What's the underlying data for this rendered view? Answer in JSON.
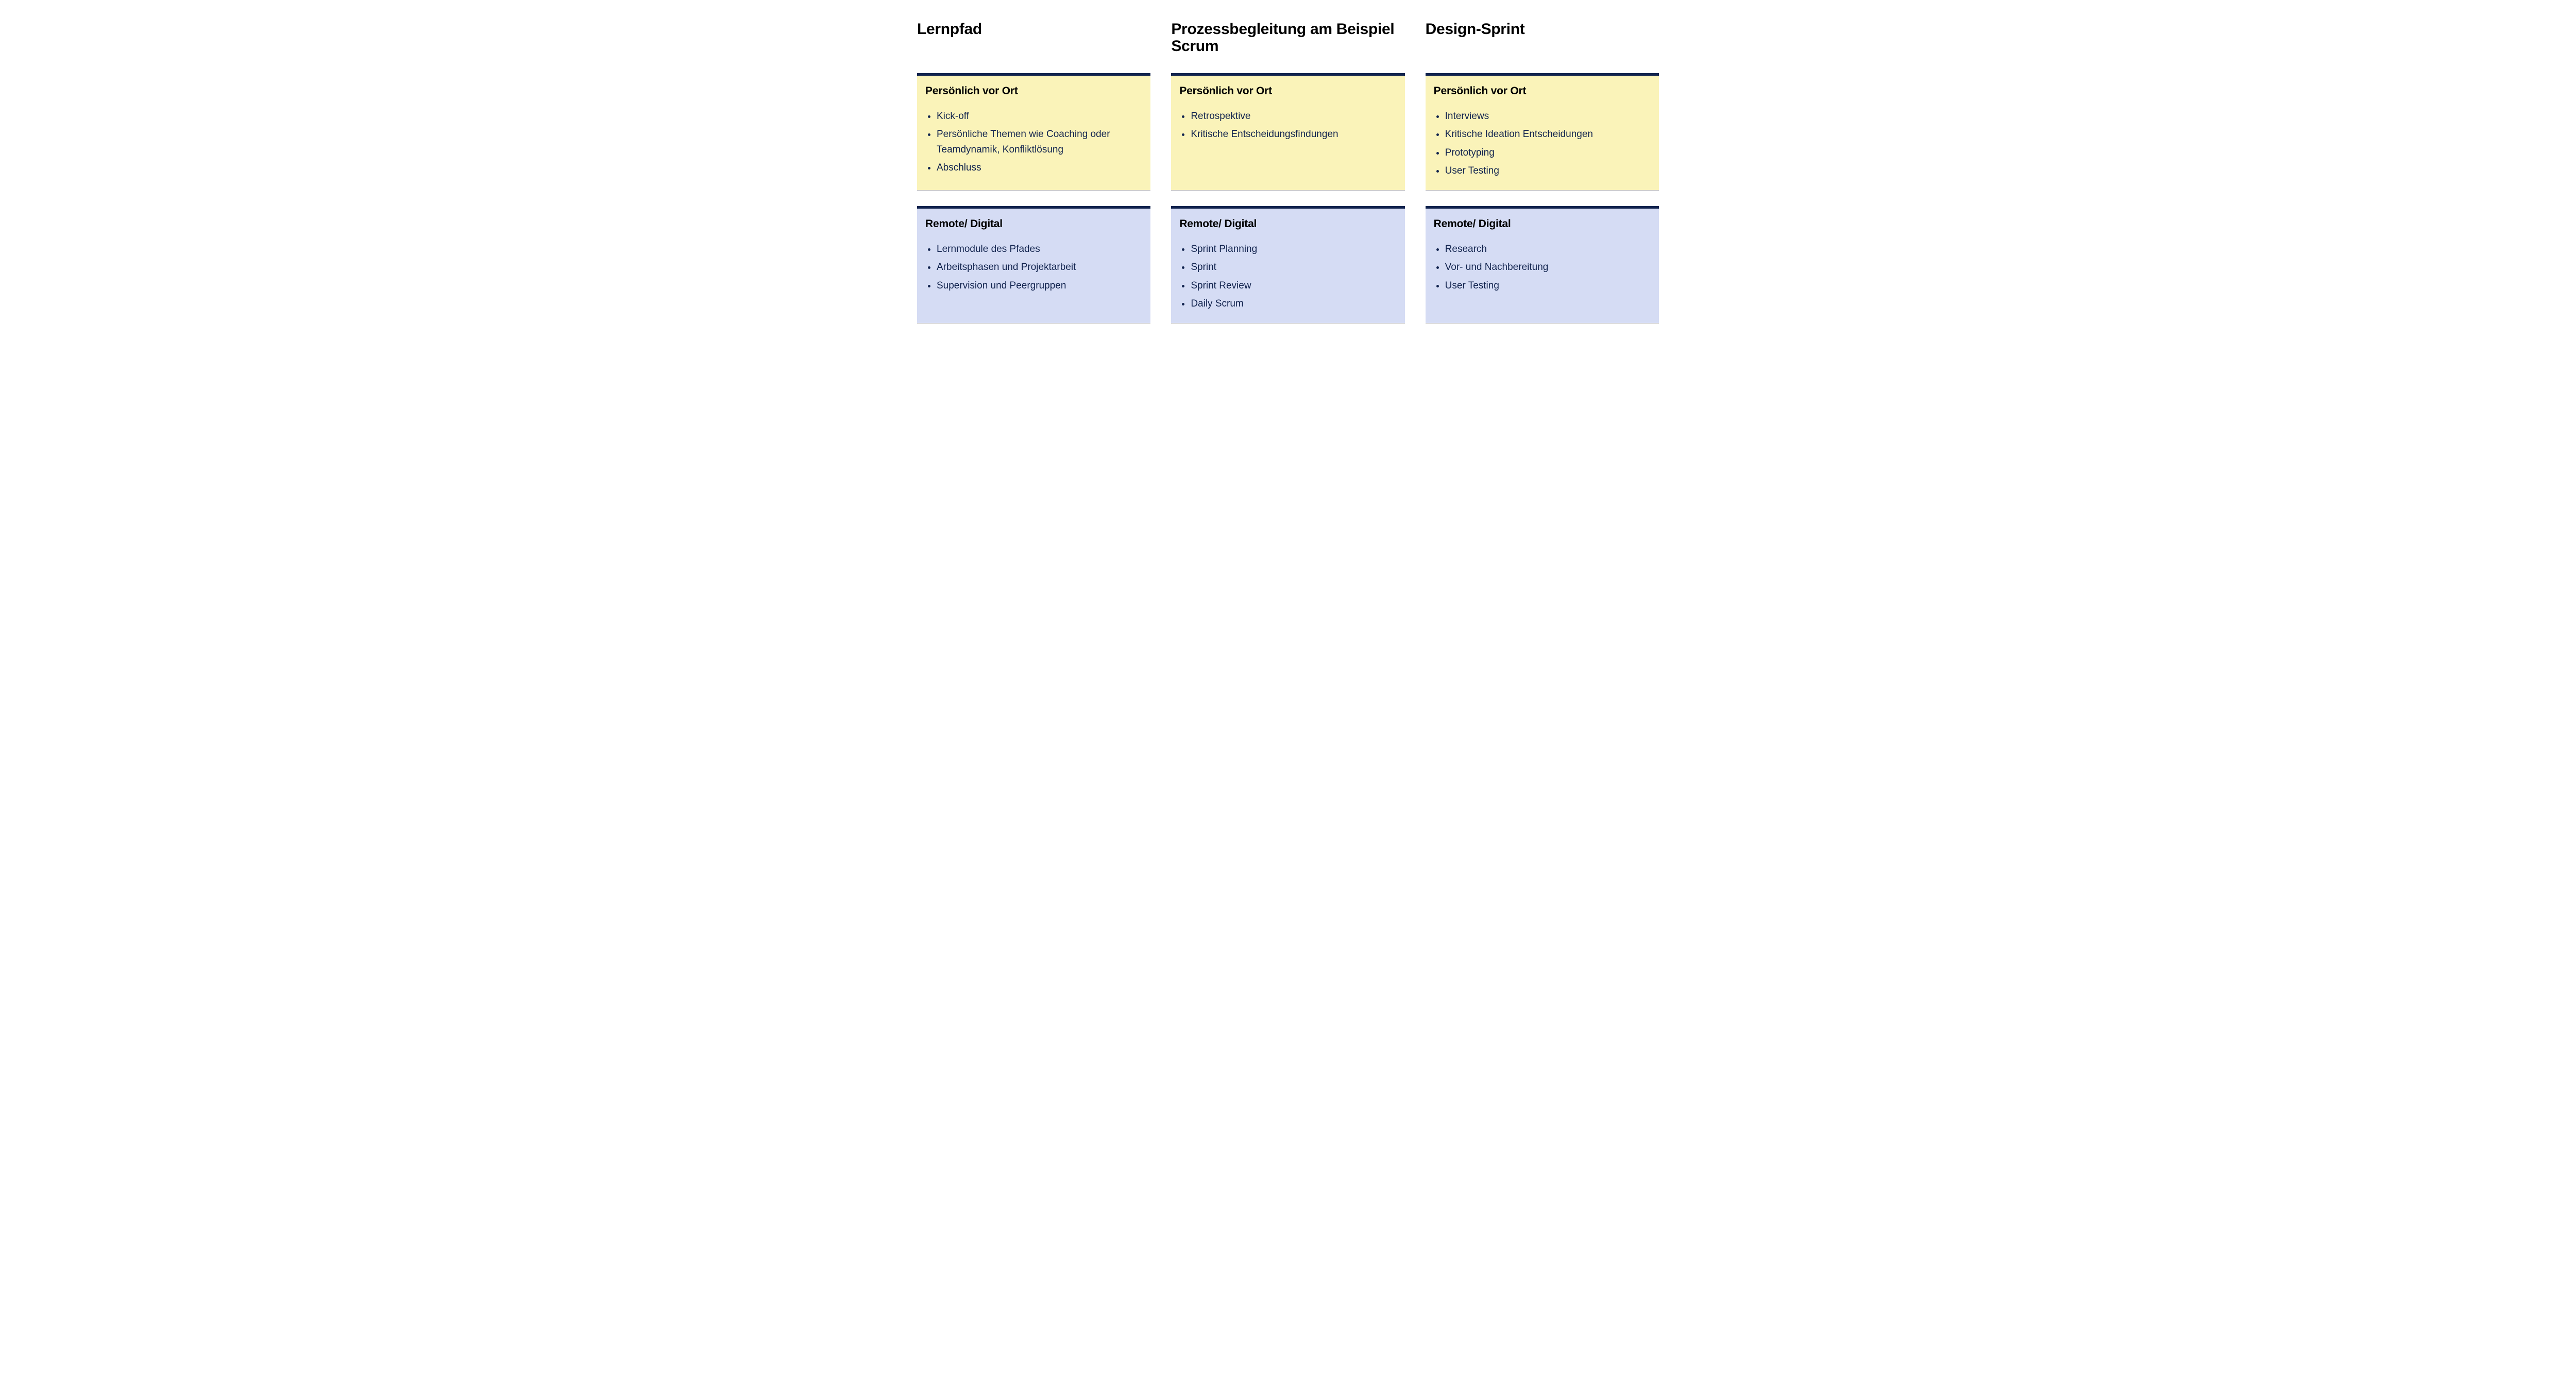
{
  "columns": [
    {
      "title": "Lernpfad",
      "onsite": {
        "heading": "Persönlich vor Ort",
        "items": [
          "Kick-off",
          "Persönliche Themen wie Coaching oder Teamdynamik, Konfliktlösung",
          "Abschluss"
        ]
      },
      "remote": {
        "heading": "Remote/ Digital",
        "items": [
          "Lernmodule des Pfades",
          "Arbeitsphasen und Projektarbeit",
          "Supervision und Peergruppen"
        ]
      }
    },
    {
      "title": "Prozessbegleitung am Beispiel Scrum",
      "onsite": {
        "heading": "Persönlich vor Ort",
        "items": [
          "Retrospektive",
          "Kritische Entscheidungsfindungen"
        ]
      },
      "remote": {
        "heading": "Remote/ Digital",
        "items": [
          "Sprint Planning",
          "Sprint",
          "Sprint Review",
          "Daily Scrum"
        ]
      }
    },
    {
      "title": "Design-Sprint",
      "onsite": {
        "heading": "Persönlich vor Ort",
        "items": [
          "Interviews",
          "Kritische Ideation Entscheidungen",
          "Prototyping",
          "User Testing"
        ]
      },
      "remote": {
        "heading": "Remote/ Digital",
        "items": [
          "Research",
          "Vor- und Nachbereitung",
          "User Testing"
        ]
      }
    }
  ]
}
